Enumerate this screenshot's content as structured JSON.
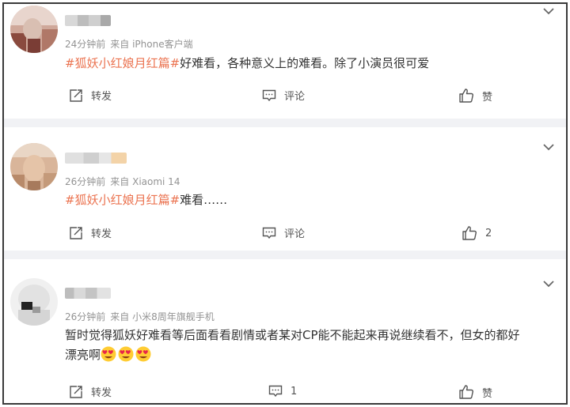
{
  "posts": [
    {
      "time": "24分钟前",
      "source": "来自 iPhone客户端",
      "tag": "#狐妖小红娘月红篇#",
      "text": "好难看，各种意义上的难看。除了小演员很可爱",
      "actions": {
        "repost": "转发",
        "comment": "评论",
        "like": "赞"
      }
    },
    {
      "time": "26分钟前",
      "source": "来自 Xiaomi 14",
      "tag": "#狐妖小红娘月红篇#",
      "text": "难看……",
      "actions": {
        "repost": "转发",
        "comment": "评论",
        "like": "2"
      }
    },
    {
      "time": "26分钟前",
      "source": "来自 小米8周年旗舰手机",
      "tag": "",
      "text_line1": "暂时觉得狐妖好难看等后面看看剧情或者某对CP能不能起来再说继续看不，但女的都好",
      "text_line2": "漂亮啊",
      "actions": {
        "repost": "转发",
        "comment": "1",
        "like": "赞"
      }
    }
  ],
  "colors": {
    "tag": "#eb7350",
    "meta": "#939393",
    "separator": "#f1f2f5"
  },
  "icons": [
    "chevron-down-icon",
    "repost-icon",
    "comment-icon",
    "like-icon",
    "heart-eyes-emoji-icon"
  ]
}
